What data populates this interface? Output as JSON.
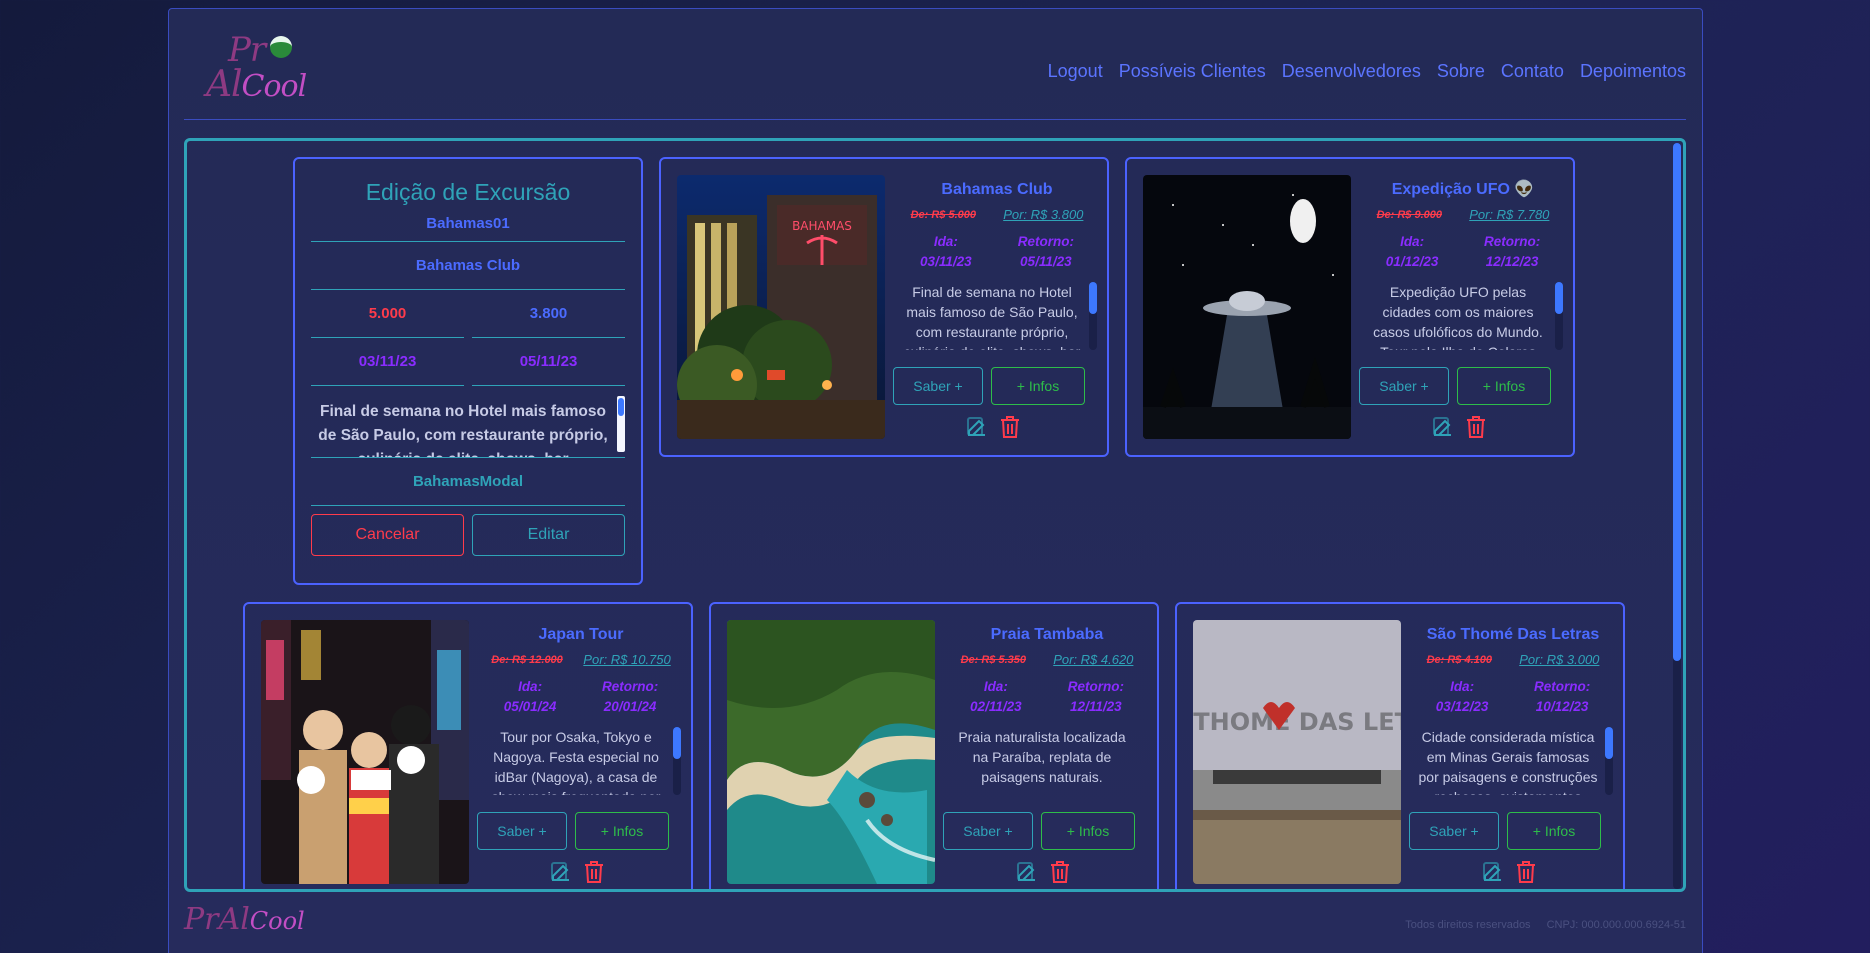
{
  "header": {
    "logo_line1": "Pr",
    "logo_line2_a": "Al",
    "logo_line2_b": "Cool",
    "nav": [
      "Logout",
      "Possíveis Clientes",
      "Desenvolvedores",
      "Sobre",
      "Contato",
      "Depoimentos"
    ]
  },
  "edit_form": {
    "title": "Edição de Excursão",
    "id": "Bahamas01",
    "name": "Bahamas Club",
    "price_old": "5.000",
    "price_new": "3.800",
    "date_start": "03/11/23",
    "date_end": "05/11/23",
    "description": "Final de semana no Hotel mais famoso de São Paulo, com restaurante próprio, culinária de elite, shows, bar",
    "modal": "BahamasModal",
    "cancel_label": "Cancelar",
    "edit_label": "Editar"
  },
  "cards": [
    {
      "title": "Bahamas Club",
      "old_price": "De: R$ 5.000",
      "new_price": "Por: R$ 3.800",
      "ida_label": "Ida:",
      "ida": "03/11/23",
      "retorno_label": "Retorno:",
      "retorno": "05/11/23",
      "description": "Final de semana no Hotel mais famoso de São Paulo, com restaurante próprio, culinária de elite, shows, bar",
      "saber_label": "Saber +",
      "infos_label": "+ Infos"
    },
    {
      "title": "Expedição UFO 👽",
      "old_price": "De: R$ 9.000",
      "new_price": "Por: R$ 7.780",
      "ida_label": "Ida:",
      "ida": "01/12/23",
      "retorno_label": "Retorno:",
      "retorno": "12/12/23",
      "description": "Expedição UFO pelas cidades com os maiores casos ufolóficos do Mundo. Tour pela Ilha de Colares",
      "saber_label": "Saber +",
      "infos_label": "+ Infos"
    },
    {
      "title": "Japan Tour",
      "old_price": "De: R$ 12.000",
      "new_price": "Por: R$ 10.750",
      "ida_label": "Ida:",
      "ida": "05/01/24",
      "retorno_label": "Retorno:",
      "retorno": "20/01/24",
      "description": "Tour por Osaka, Tokyo e Nagoya. Festa especial no idBar (Nagoya), a casa de show mais frequentada por",
      "saber_label": "Saber +",
      "infos_label": "+ Infos"
    },
    {
      "title": "Praia Tambaba",
      "old_price": "De: R$ 5.350",
      "new_price": "Por: R$ 4.620",
      "ida_label": "Ida:",
      "ida": "02/11/23",
      "retorno_label": "Retorno:",
      "retorno": "12/11/23",
      "description": "Praia naturalista localizada na Paraíba, replata de paisagens naturais.",
      "saber_label": "Saber +",
      "infos_label": "+ Infos"
    },
    {
      "title": "São Thomé Das Letras",
      "old_price": "De: R$ 4.100",
      "new_price": "Por: R$ 3.000",
      "ida_label": "Ida:",
      "ida": "03/12/23",
      "retorno_label": "Retorno:",
      "retorno": "10/12/23",
      "description": "Cidade considerada mística em Minas Gerais famosas por paisagens e construções rochosas, avistamentos",
      "saber_label": "Saber +",
      "infos_label": "+ Infos",
      "image_text": "SÃO THOMÉ DAS LETRAS"
    }
  ],
  "footer": {
    "rights": "Todos direitos reservados",
    "cnpj": "CNPJ: 000.000.000.6924-51"
  }
}
